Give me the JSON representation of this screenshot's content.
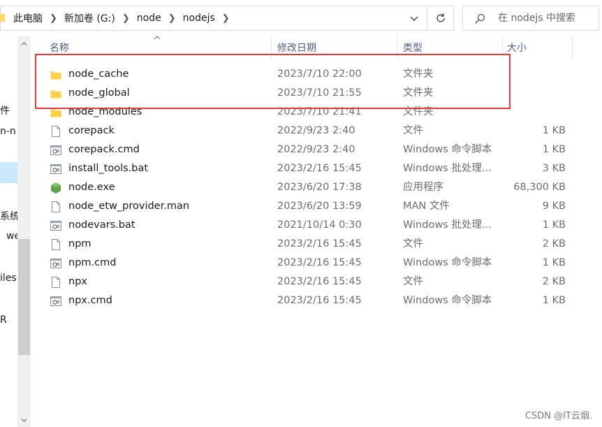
{
  "address": {
    "crumbs": [
      "此电脑",
      "新加卷 (G:)",
      "node",
      "nodejs"
    ]
  },
  "search": {
    "placeholder": "在 nodejs 中搜索"
  },
  "nav": {
    "fragments": [
      "件",
      "n-n",
      "系统",
      "we",
      "iles",
      "R"
    ]
  },
  "columns": {
    "name": "名称",
    "date": "修改日期",
    "type": "类型",
    "size": "大小"
  },
  "files": [
    {
      "name": "node_cache",
      "date": "2023/7/10 22:00",
      "type": "文件夹",
      "size": "",
      "icon": "folder-icon"
    },
    {
      "name": "node_global",
      "date": "2023/7/10 21:55",
      "type": "文件夹",
      "size": "",
      "icon": "folder-icon"
    },
    {
      "name": "node_modules",
      "date": "2023/7/10 21:41",
      "type": "文件夹",
      "size": "",
      "icon": "folder-icon"
    },
    {
      "name": "corepack",
      "date": "2022/9/23 2:40",
      "type": "文件",
      "size": "1 KB",
      "icon": "file-icon"
    },
    {
      "name": "corepack.cmd",
      "date": "2022/9/23 2:40",
      "type": "Windows 命令脚本",
      "size": "1 KB",
      "icon": "script-icon"
    },
    {
      "name": "install_tools.bat",
      "date": "2023/2/16 15:45",
      "type": "Windows 批处理...",
      "size": "3 KB",
      "icon": "script-icon"
    },
    {
      "name": "node.exe",
      "date": "2023/6/20 17:38",
      "type": "应用程序",
      "size": "68,300 KB",
      "icon": "node-exe-icon"
    },
    {
      "name": "node_etw_provider.man",
      "date": "2023/6/20 13:59",
      "type": "MAN 文件",
      "size": "9 KB",
      "icon": "file-icon"
    },
    {
      "name": "nodevars.bat",
      "date": "2021/10/14 0:30",
      "type": "Windows 批处理...",
      "size": "1 KB",
      "icon": "script-icon"
    },
    {
      "name": "npm",
      "date": "2023/2/16 15:45",
      "type": "文件",
      "size": "2 KB",
      "icon": "file-icon"
    },
    {
      "name": "npm.cmd",
      "date": "2023/2/16 15:45",
      "type": "Windows 命令脚本",
      "size": "1 KB",
      "icon": "script-icon"
    },
    {
      "name": "npx",
      "date": "2023/2/16 15:45",
      "type": "文件",
      "size": "2 KB",
      "icon": "file-icon"
    },
    {
      "name": "npx.cmd",
      "date": "2023/2/16 15:45",
      "type": "Windows 命令脚本",
      "size": "1 KB",
      "icon": "script-icon"
    }
  ],
  "watermark": "CSDN @IT云烟.",
  "colors": {
    "folder": "#ffd766",
    "highlight": "#e03a3a",
    "header_text": "#4d6082",
    "node_green": "#5fa04e"
  }
}
